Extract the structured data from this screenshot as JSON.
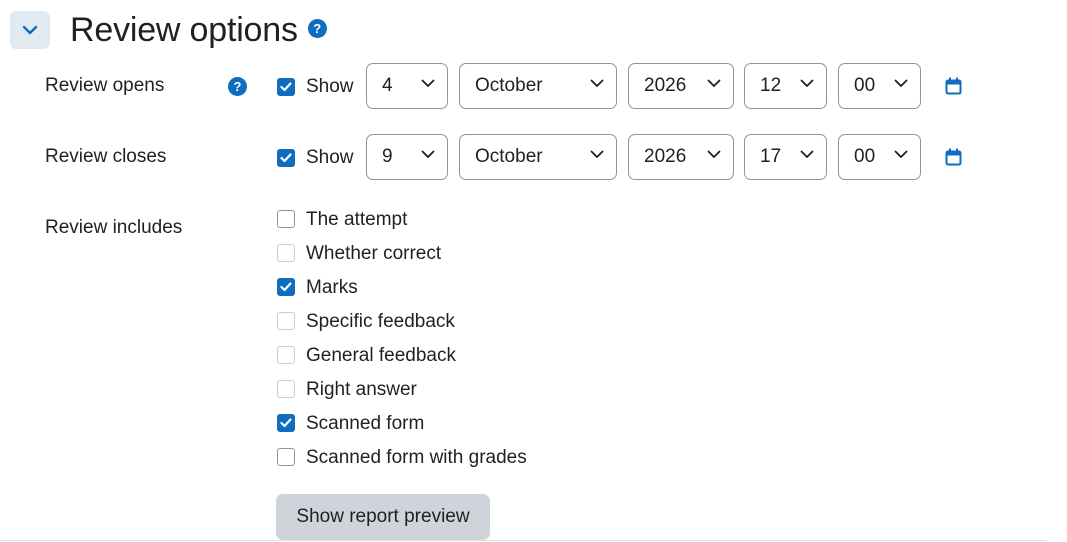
{
  "section": {
    "title": "Review options",
    "help": "?"
  },
  "review_opens": {
    "label": "Review opens",
    "help": "?",
    "show_label": "Show",
    "show_checked": true,
    "day": "4",
    "month": "October",
    "year": "2026",
    "hour": "12",
    "minute": "00"
  },
  "review_closes": {
    "label": "Review closes",
    "show_label": "Show",
    "show_checked": true,
    "day": "9",
    "month": "October",
    "year": "2026",
    "hour": "17",
    "minute": "00"
  },
  "review_includes": {
    "label": "Review includes",
    "options": [
      {
        "label": "The attempt",
        "checked": false,
        "disabled": false
      },
      {
        "label": "Whether correct",
        "checked": false,
        "disabled": true
      },
      {
        "label": "Marks",
        "checked": true,
        "disabled": false
      },
      {
        "label": "Specific feedback",
        "checked": false,
        "disabled": true
      },
      {
        "label": "General feedback",
        "checked": false,
        "disabled": true
      },
      {
        "label": "Right answer",
        "checked": false,
        "disabled": true
      },
      {
        "label": "Scanned form",
        "checked": true,
        "disabled": false
      },
      {
        "label": "Scanned form with grades",
        "checked": false,
        "disabled": false
      }
    ]
  },
  "preview_button": {
    "label": "Show report preview"
  },
  "colors": {
    "accent": "#0f6cbf",
    "button_bg": "#ced4da",
    "collapse_bg": "#e2eaf1"
  }
}
